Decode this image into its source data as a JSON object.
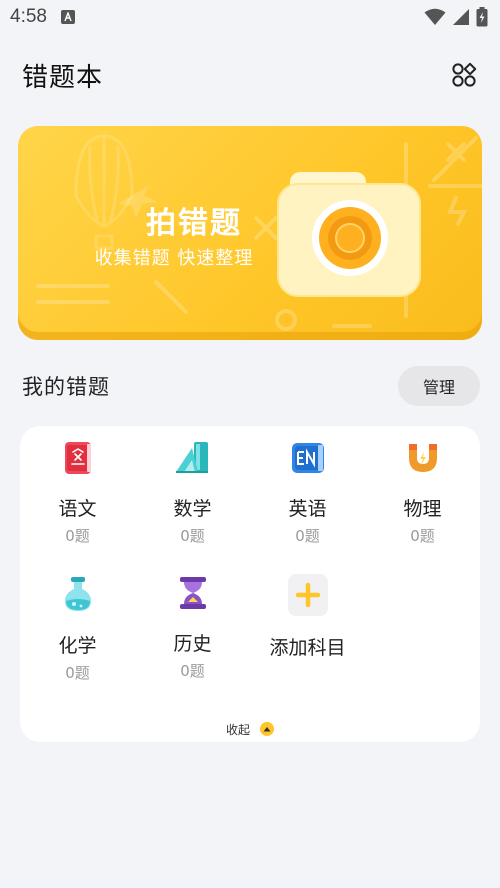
{
  "status_bar": {
    "time": "4:58"
  },
  "header": {
    "title": "错题本"
  },
  "banner": {
    "title": "拍错题",
    "subtitle": "收集错题 快速整理"
  },
  "section": {
    "title": "我的错题",
    "manage_label": "管理"
  },
  "subjects": [
    {
      "name": "语文",
      "count": "0题",
      "icon": "book-icon",
      "color": "#f0485a"
    },
    {
      "name": "数学",
      "count": "0题",
      "icon": "geometry-icon",
      "color": "#31c6c9"
    },
    {
      "name": "英语",
      "count": "0题",
      "icon": "en-book-icon",
      "color": "#2f86e8"
    },
    {
      "name": "物理",
      "count": "0题",
      "icon": "magnet-icon",
      "color": "#f09a2b"
    },
    {
      "name": "化学",
      "count": "0题",
      "icon": "flask-icon",
      "color": "#3fc6d4"
    },
    {
      "name": "历史",
      "count": "0题",
      "icon": "hourglass-icon",
      "color": "#8b52c8"
    }
  ],
  "add_subject": {
    "label": "添加科目"
  },
  "collapse": {
    "label": "收起"
  },
  "colors": {
    "accent": "#ffc629",
    "background": "#f3f4f8"
  }
}
